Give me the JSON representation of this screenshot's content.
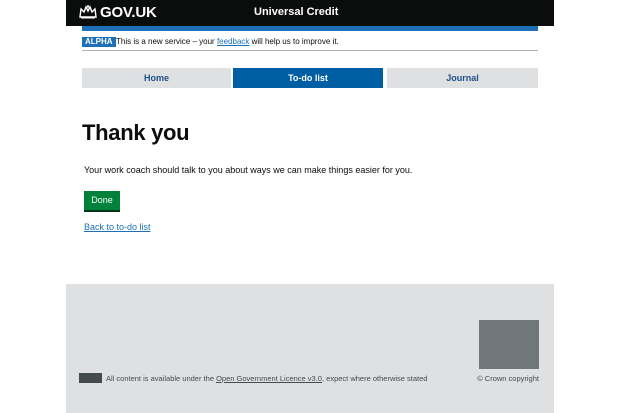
{
  "header": {
    "logo_text": "GOV.UK",
    "service_name": "Universal Credit",
    "logo_icon": "crown-icon",
    "stripe_color": "#1d70b8"
  },
  "phase_banner": {
    "tag": "ALPHA",
    "text_before": "This is a new service – your ",
    "link_text": "feedback",
    "text_after": " will help us to improve it."
  },
  "nav": {
    "tabs": [
      {
        "label": "Home",
        "active": false
      },
      {
        "label": "To-do list",
        "active": true
      },
      {
        "label": "Journal",
        "active": false
      }
    ],
    "active_color": "#005ea5"
  },
  "main": {
    "title": "Thank you",
    "body": "Your work coach should talk to you about ways we can make things easier for you.",
    "done_label": "Done",
    "done_color": "#00823b",
    "back_link": "Back to to-do list"
  },
  "footer": {
    "licence_before": "All content is available under the ",
    "licence_link": "Open Government Licence v3.0",
    "licence_after": ", expect where otherwise stated",
    "copyright": "© Crown copyright"
  }
}
